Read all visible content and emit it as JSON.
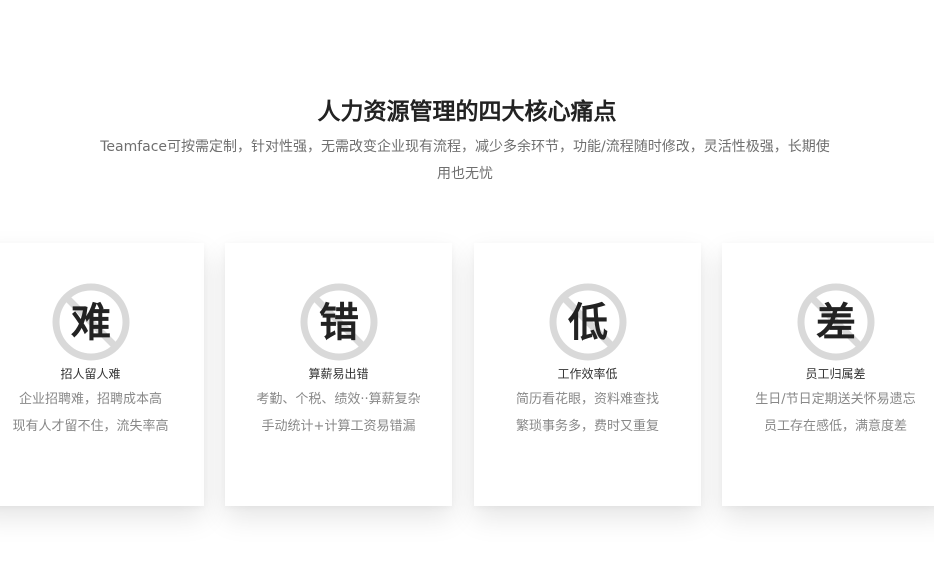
{
  "section": {
    "title": "人力资源管理的四大核心痛点",
    "description": "Teamface可按需定制，针对性强，无需改变企业现有流程，减少多余环节，功能/流程随时修改，灵活性极强，长期使用也无忧"
  },
  "cards": [
    {
      "icon_char": "难",
      "icon": "no-sign-icon",
      "title": "招人留人难",
      "lines": [
        "企业招聘难，招聘成本高",
        "现有人才留不住，流失率高"
      ]
    },
    {
      "icon_char": "错",
      "icon": "no-sign-icon",
      "title": "算薪易出错",
      "lines": [
        "考勤、个税、绩效··算薪复杂",
        "手动统计+计算工资易错漏"
      ]
    },
    {
      "icon_char": "低",
      "icon": "no-sign-icon",
      "title": "工作效率低",
      "lines": [
        "简历看花眼，资料难查找",
        "繁琐事务多，费时又重复"
      ]
    },
    {
      "icon_char": "差",
      "icon": "no-sign-icon",
      "title": "员工归属差",
      "lines": [
        "生日/节日定期送关怀易遗忘",
        "员工存在感低，满意度差"
      ]
    }
  ],
  "colors": {
    "title": "#222222",
    "text_muted": "#888888",
    "icon_ring": "#d9d9d9",
    "icon_char": "#222222"
  }
}
